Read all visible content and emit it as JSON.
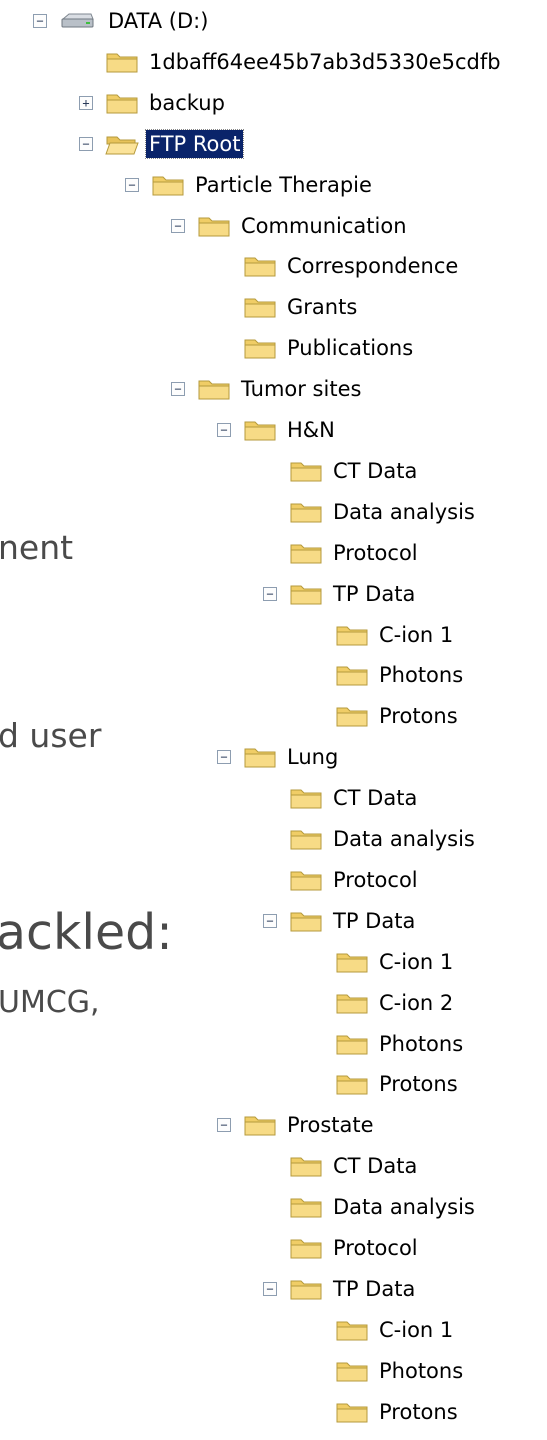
{
  "background_text": [
    "nent",
    "d  user",
    "ackled:",
    "UMCG,"
  ],
  "tree": [
    {
      "label": "DATA (D:)",
      "depth": 0,
      "toggle": "−",
      "icon": "drive-icon"
    },
    {
      "label": "1dbaff64ee45b7ab3d5330e5cdfb",
      "depth": 1,
      "toggle": "",
      "icon": "folder-icon"
    },
    {
      "label": "backup",
      "depth": 1,
      "toggle": "+",
      "icon": "folder-icon"
    },
    {
      "label": "FTP Root",
      "depth": 1,
      "toggle": "−",
      "icon": "folder-open-icon",
      "selected": true
    },
    {
      "label": "Particle Therapie",
      "depth": 2,
      "toggle": "−",
      "icon": "folder-icon"
    },
    {
      "label": "Communication",
      "depth": 3,
      "toggle": "−",
      "icon": "folder-icon"
    },
    {
      "label": "Correspondence",
      "depth": 4,
      "toggle": "",
      "icon": "folder-icon"
    },
    {
      "label": "Grants",
      "depth": 4,
      "toggle": "",
      "icon": "folder-icon"
    },
    {
      "label": "Publications",
      "depth": 4,
      "toggle": "",
      "icon": "folder-icon"
    },
    {
      "label": "Tumor sites",
      "depth": 3,
      "toggle": "−",
      "icon": "folder-icon"
    },
    {
      "label": "H&N",
      "depth": 4,
      "toggle": "−",
      "icon": "folder-icon"
    },
    {
      "label": "CT Data",
      "depth": 5,
      "toggle": "",
      "icon": "folder-icon"
    },
    {
      "label": "Data analysis",
      "depth": 5,
      "toggle": "",
      "icon": "folder-icon"
    },
    {
      "label": "Protocol",
      "depth": 5,
      "toggle": "",
      "icon": "folder-icon"
    },
    {
      "label": "TP Data",
      "depth": 5,
      "toggle": "−",
      "icon": "folder-icon"
    },
    {
      "label": "C-ion 1",
      "depth": 6,
      "toggle": "",
      "icon": "folder-icon"
    },
    {
      "label": "Photons",
      "depth": 6,
      "toggle": "",
      "icon": "folder-icon"
    },
    {
      "label": "Protons",
      "depth": 6,
      "toggle": "",
      "icon": "folder-icon"
    },
    {
      "label": "Lung",
      "depth": 4,
      "toggle": "−",
      "icon": "folder-icon"
    },
    {
      "label": "CT Data",
      "depth": 5,
      "toggle": "",
      "icon": "folder-icon"
    },
    {
      "label": "Data analysis",
      "depth": 5,
      "toggle": "",
      "icon": "folder-icon"
    },
    {
      "label": "Protocol",
      "depth": 5,
      "toggle": "",
      "icon": "folder-icon"
    },
    {
      "label": "TP Data",
      "depth": 5,
      "toggle": "−",
      "icon": "folder-icon"
    },
    {
      "label": "C-ion 1",
      "depth": 6,
      "toggle": "",
      "icon": "folder-icon"
    },
    {
      "label": "C-ion 2",
      "depth": 6,
      "toggle": "",
      "icon": "folder-icon"
    },
    {
      "label": "Photons",
      "depth": 6,
      "toggle": "",
      "icon": "folder-icon"
    },
    {
      "label": "Protons",
      "depth": 6,
      "toggle": "",
      "icon": "folder-icon"
    },
    {
      "label": "Prostate",
      "depth": 4,
      "toggle": "−",
      "icon": "folder-icon"
    },
    {
      "label": "CT Data",
      "depth": 5,
      "toggle": "",
      "icon": "folder-icon"
    },
    {
      "label": "Data analysis",
      "depth": 5,
      "toggle": "",
      "icon": "folder-icon"
    },
    {
      "label": "Protocol",
      "depth": 5,
      "toggle": "",
      "icon": "folder-icon"
    },
    {
      "label": "TP Data",
      "depth": 5,
      "toggle": "−",
      "icon": "folder-icon"
    },
    {
      "label": "C-ion 1",
      "depth": 6,
      "toggle": "",
      "icon": "folder-icon"
    },
    {
      "label": "Photons",
      "depth": 6,
      "toggle": "",
      "icon": "folder-icon"
    },
    {
      "label": "Protons",
      "depth": 6,
      "toggle": "",
      "icon": "folder-icon"
    }
  ],
  "colors": {
    "selection": "#0a246a",
    "folder": "#f4d77c",
    "folder_edge": "#b59a3c",
    "slide_text": "#4a4a4a"
  }
}
